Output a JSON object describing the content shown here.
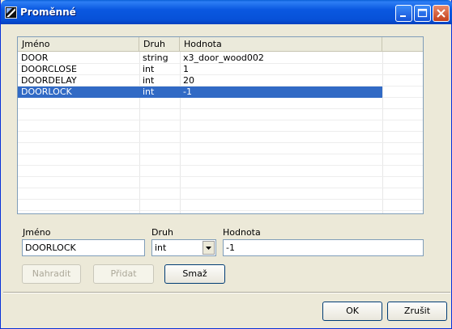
{
  "window": {
    "title": "Proměnné"
  },
  "list": {
    "columns": [
      "Jméno",
      "Druh",
      "Hodnota"
    ],
    "rows": [
      {
        "name": "DOOR",
        "type": "string",
        "value": "x3_door_wood002"
      },
      {
        "name": "DOORCLOSE",
        "type": "int",
        "value": "1"
      },
      {
        "name": "DOORDELAY",
        "type": "int",
        "value": "20"
      },
      {
        "name": "DOORLOCK",
        "type": "int",
        "value": "-1"
      }
    ],
    "selected_index": 3
  },
  "form": {
    "name_label": "Jméno",
    "type_label": "Druh",
    "value_label": "Hodnota",
    "name_value": "DOORLOCK",
    "type_value": "int",
    "value_value": "-1"
  },
  "buttons": {
    "replace": "Nahradit",
    "add": "Přidat",
    "delete": "Smaž",
    "ok": "OK",
    "cancel": "Zrušit"
  },
  "colors": {
    "selection": "#316ac5",
    "titlebar": "#0a58e0"
  }
}
